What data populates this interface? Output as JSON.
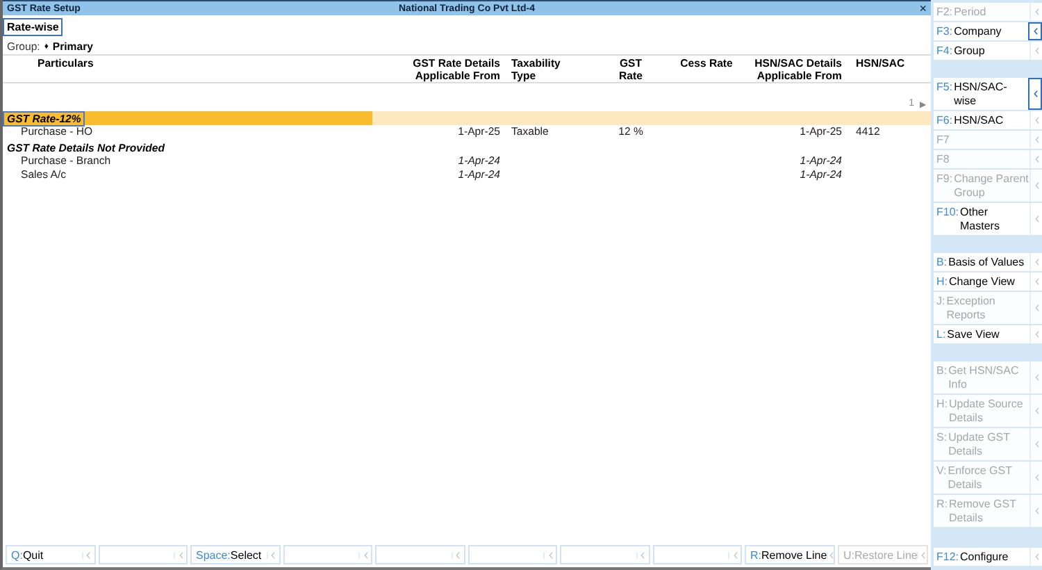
{
  "window": {
    "title": "GST Rate Setup",
    "company": "National Trading Co Pvt Ltd-4",
    "close": "×"
  },
  "view": {
    "label": "Rate-wise"
  },
  "group": {
    "label": "Group:",
    "bullet": "♦",
    "value": "Primary"
  },
  "table": {
    "columns": [
      "Particulars",
      "GST Rate Details Applicable From",
      "Taxability Type",
      "GST Rate",
      "Cess Rate",
      "HSN/SAC Details Applicable From",
      "HSN/SAC"
    ],
    "page": "1",
    "next": "▶",
    "groups": [
      {
        "name": "GST Rate-12%",
        "selected": true,
        "children": [
          {
            "cells": [
              "Purchase - HO",
              "1-Apr-25",
              "Taxable",
              "12 %",
              null,
              "1-Apr-25",
              "4412"
            ],
            "inherited": false
          }
        ]
      },
      {
        "name": "GST Rate Details Not Provided",
        "selected": false,
        "children": [
          {
            "cells": [
              "Purchase - Branch",
              "1-Apr-24",
              null,
              null,
              null,
              "1-Apr-24",
              null
            ],
            "inherited": true
          },
          {
            "cells": [
              "Sales A/c",
              "1-Apr-24",
              null,
              null,
              null,
              "1-Apr-24",
              null
            ],
            "inherited": true
          }
        ]
      }
    ]
  },
  "sidebar": {
    "sections": [
      [
        {
          "key": "F2:",
          "label": "Period",
          "disabled": true,
          "has_menu": false
        },
        {
          "key": "F3:",
          "label": "Company",
          "disabled": false,
          "has_menu": true
        },
        {
          "key": "F4:",
          "label": "Group",
          "disabled": false,
          "has_menu": false
        }
      ],
      [
        {
          "key": "F5:",
          "label": "HSN/SAC-wise",
          "disabled": false,
          "has_menu": true
        },
        {
          "key": "F6:",
          "label": "HSN/SAC",
          "disabled": false,
          "has_menu": false
        },
        {
          "key": "F7",
          "disabled": true,
          "has_menu": false
        },
        {
          "key": "F8",
          "disabled": true,
          "has_menu": false
        },
        {
          "key": "F9:",
          "label": "Change Parent Group",
          "disabled": true,
          "has_menu": false
        },
        {
          "key": "F10:",
          "label": "Other Masters",
          "disabled": false,
          "has_menu": false
        }
      ],
      [
        {
          "key": "B:",
          "label": "Basis of Values",
          "disabled": false,
          "has_menu": false
        },
        {
          "key": "H:",
          "label": "Change View",
          "disabled": false,
          "has_menu": false
        },
        {
          "key": "J:",
          "label": "Exception Reports",
          "disabled": true,
          "has_menu": false
        },
        {
          "key": "L:",
          "label": "Save View",
          "disabled": false,
          "has_menu": false
        }
      ],
      [
        {
          "key": "B:",
          "label": "Get HSN/SAC Info",
          "disabled": true,
          "has_menu": false
        },
        {
          "key": "H:",
          "label": "Update Source Details",
          "disabled": true,
          "has_menu": false
        },
        {
          "key": "S:",
          "label": "Update GST Details",
          "disabled": true,
          "has_menu": false
        },
        {
          "key": "V:",
          "label": "Enforce GST Details",
          "disabled": true,
          "has_menu": false
        },
        {
          "key": "R:",
          "label": "Remove GST Details",
          "disabled": true,
          "has_menu": false
        }
      ],
      [
        {
          "key": "F12:",
          "label": "Configure",
          "disabled": false,
          "has_menu": false
        }
      ]
    ]
  },
  "footer": [
    {
      "kind": "action",
      "key": "Q:",
      "label": "Quit",
      "disabled": false
    },
    {
      "kind": "blank"
    },
    {
      "kind": "action",
      "key": "Space:",
      "label": "Select",
      "disabled": false
    },
    {
      "kind": "blank"
    },
    {
      "kind": "blank"
    },
    {
      "kind": "blank"
    },
    {
      "kind": "blank"
    },
    {
      "kind": "blank"
    },
    {
      "kind": "action",
      "key": "R:",
      "label": "Remove Line",
      "disabled": false
    },
    {
      "kind": "action",
      "key": "U:",
      "label": "Restore Line",
      "disabled": true
    }
  ]
}
